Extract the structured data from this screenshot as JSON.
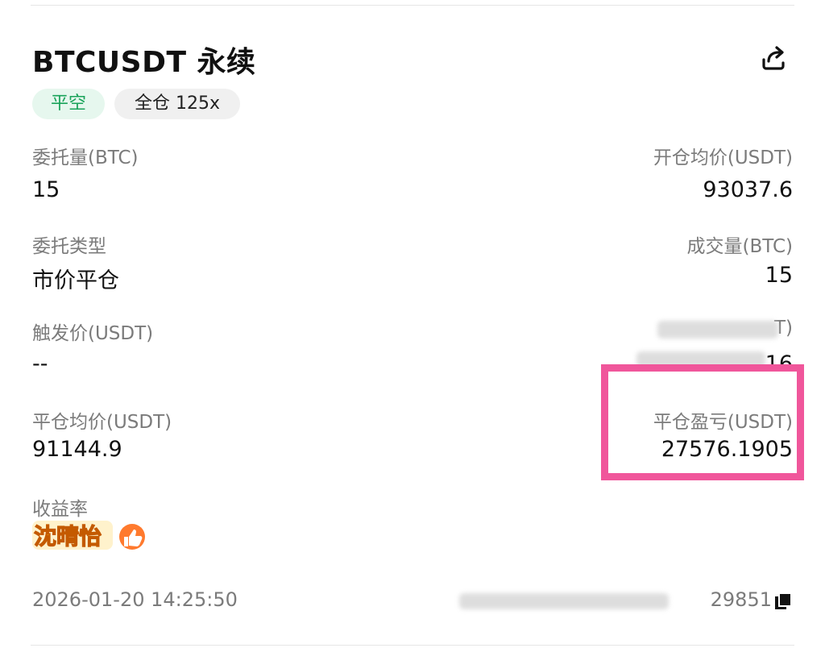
{
  "header": {
    "title": "BTCUSDT 永续",
    "tags": {
      "side": "平空",
      "margin": "全仓 125x"
    }
  },
  "fields": {
    "order_qty_label": "委托量(BTC)",
    "order_qty_value": "15",
    "open_avg_label": "开仓均价(USDT)",
    "open_avg_value": "93037.6",
    "order_type_label": "委托类型",
    "order_type_value": "市价平仓",
    "filled_qty_label": "成交量(BTC)",
    "filled_qty_value": "15",
    "trigger_price_label": "触发价(USDT)",
    "trigger_price_value": "--",
    "fee_label_partial": "T)",
    "fee_value_partial": "16",
    "close_avg_label": "平仓均价(USDT)",
    "close_avg_value": "91144.9",
    "pnl_label": "平仓盈亏(USDT)",
    "pnl_value": "27576.1905",
    "roi_label": "收益率"
  },
  "sticker": {
    "text": "沈晴怡"
  },
  "footer": {
    "timestamp": "2026-01-20 14:25:50",
    "order_id_visible": "29851"
  },
  "colors": {
    "green_tag_bg": "#e6f7ee",
    "green_tag_text": "#1aa35a",
    "highlight_border": "#f0569b"
  },
  "chart_data": {
    "type": "table",
    "title": "BTCUSDT 永续",
    "rows": [
      {
        "label": "委托量(BTC)",
        "value": "15"
      },
      {
        "label": "开仓均价(USDT)",
        "value": "93037.6"
      },
      {
        "label": "委托类型",
        "value": "市价平仓"
      },
      {
        "label": "成交量(BTC)",
        "value": "15"
      },
      {
        "label": "触发价(USDT)",
        "value": "--"
      },
      {
        "label": "平仓均价(USDT)",
        "value": "91144.9"
      },
      {
        "label": "平仓盈亏(USDT)",
        "value": "27576.1905"
      },
      {
        "label": "收益率",
        "value": ""
      }
    ]
  }
}
